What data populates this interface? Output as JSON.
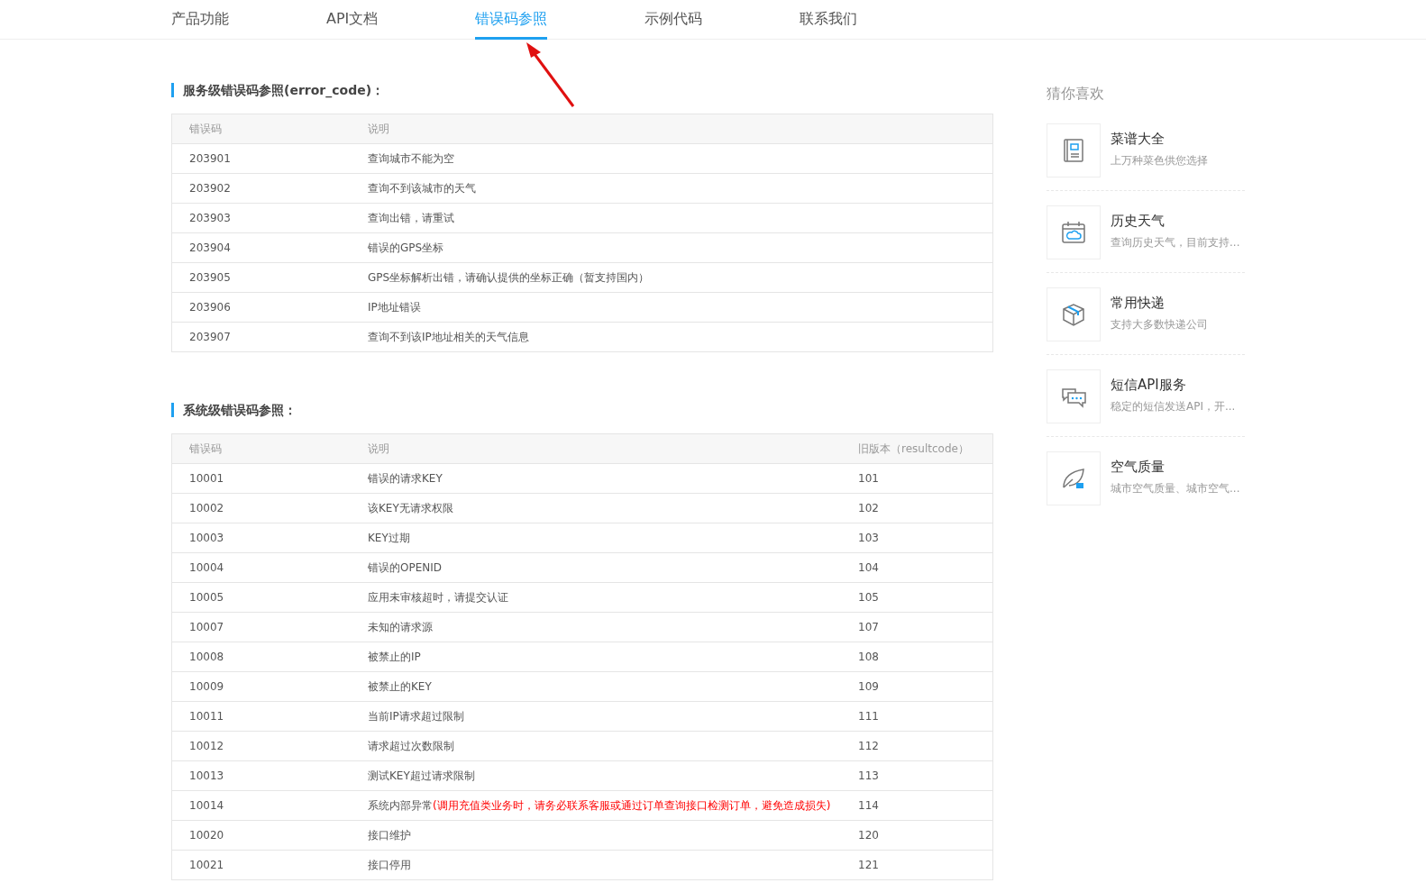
{
  "nav": {
    "tabs": [
      {
        "label": "产品功能",
        "selected": false
      },
      {
        "label": "API文档",
        "selected": false
      },
      {
        "label": "错误码参照",
        "selected": true
      },
      {
        "label": "示例代码",
        "selected": false
      },
      {
        "label": "联系我们",
        "selected": false
      }
    ]
  },
  "sections": [
    {
      "title": "服务级错误码参照(error_code)：",
      "columns": [
        "错误码",
        "说明"
      ],
      "rows": [
        {
          "cells": [
            "203901",
            "查询城市不能为空"
          ]
        },
        {
          "cells": [
            "203902",
            "查询不到该城市的天气"
          ]
        },
        {
          "cells": [
            "203903",
            "查询出错，请重试"
          ]
        },
        {
          "cells": [
            "203904",
            "错误的GPS坐标"
          ]
        },
        {
          "cells": [
            "203905",
            "GPS坐标解析出错，请确认提供的坐标正确（暂支持国内）"
          ]
        },
        {
          "cells": [
            "203906",
            "IP地址错误"
          ]
        },
        {
          "cells": [
            "203907",
            "查询不到该IP地址相关的天气信息"
          ]
        }
      ]
    },
    {
      "title": "系统级错误码参照：",
      "columns": [
        "错误码",
        "说明",
        "旧版本（resultcode）"
      ],
      "rows": [
        {
          "cells": [
            "10001",
            "错误的请求KEY",
            "101"
          ]
        },
        {
          "cells": [
            "10002",
            "该KEY无请求权限",
            "102"
          ]
        },
        {
          "cells": [
            "10003",
            "KEY过期",
            "103"
          ]
        },
        {
          "cells": [
            "10004",
            "错误的OPENID",
            "104"
          ]
        },
        {
          "cells": [
            "10005",
            "应用未审核超时，请提交认证",
            "105"
          ]
        },
        {
          "cells": [
            "10007",
            "未知的请求源",
            "107"
          ]
        },
        {
          "cells": [
            "10008",
            "被禁止的IP",
            "108"
          ]
        },
        {
          "cells": [
            "10009",
            "被禁止的KEY",
            "109"
          ]
        },
        {
          "cells": [
            "10011",
            "当前IP请求超过限制",
            "111"
          ]
        },
        {
          "cells": [
            "10012",
            "请求超过次数限制",
            "112"
          ]
        },
        {
          "cells": [
            "10013",
            "测试KEY超过请求限制",
            "113"
          ]
        },
        {
          "cells": [
            "10014",
            "系统内部异常",
            "114"
          ],
          "note": "(调用充值类业务时，请务必联系客服或通过订单查询接口检测订单，避免造成损失)"
        },
        {
          "cells": [
            "10020",
            "接口维护",
            "120"
          ]
        },
        {
          "cells": [
            "10021",
            "接口停用",
            "121"
          ]
        }
      ]
    }
  ],
  "sidebar": {
    "title": "猜你喜欢",
    "items": [
      {
        "kind": "recipe",
        "name": "菜谱大全",
        "description": "上万种菜色供您选择"
      },
      {
        "kind": "weather",
        "name": "历史天气",
        "description": "查询历史天气，目前支持..."
      },
      {
        "kind": "express",
        "name": "常用快递",
        "description": "支持大多数快递公司"
      },
      {
        "kind": "sms",
        "name": "短信API服务",
        "description": "稳定的短信发送API，开..."
      },
      {
        "kind": "air",
        "name": "空气质量",
        "description": "城市空气质量、城市空气..."
      }
    ]
  }
}
